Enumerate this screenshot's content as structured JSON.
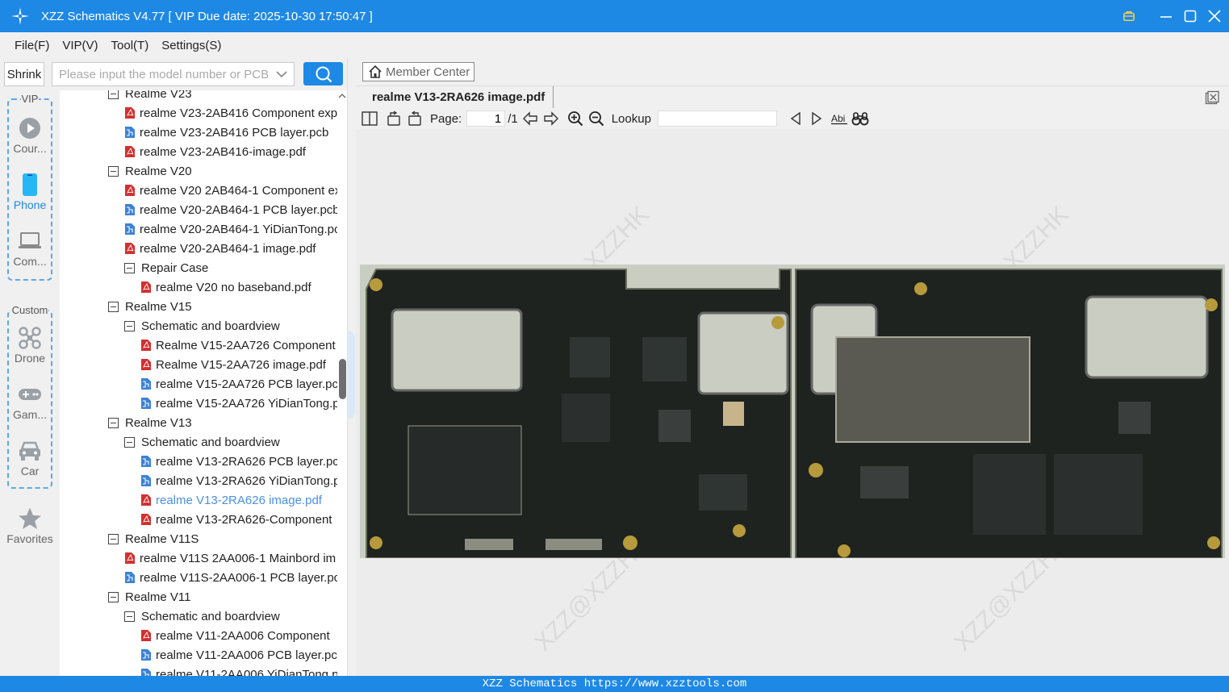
{
  "app": {
    "title": "XZZ Schematics V4.77 [ VIP Due date: 2025-10-30 17:50:47 ]",
    "accent": "#1e88e5"
  },
  "menu": [
    "File(F)",
    "VIP(V)",
    "Tool(T)",
    "Settings(S)"
  ],
  "rail": {
    "shrink_label": "Shrink",
    "vip_label": "VIP",
    "custom_label": "Custom",
    "items": [
      {
        "label": "Cour...",
        "icon": "play-icon"
      },
      {
        "label": "Phone",
        "icon": "phone-icon"
      },
      {
        "label": "Com...",
        "icon": "laptop-icon"
      },
      {
        "label": "Drone",
        "icon": "drone-icon"
      },
      {
        "label": "Gam...",
        "icon": "gamepad-icon"
      },
      {
        "label": "Car",
        "icon": "car-icon"
      },
      {
        "label": "Favorites",
        "icon": "star-icon"
      }
    ]
  },
  "search": {
    "placeholder": "Please input the model number or PCB"
  },
  "tree": [
    {
      "level": 0,
      "type": "folder",
      "label": "Realme V23",
      "partial": true
    },
    {
      "level": 1,
      "type": "pdf",
      "label": "realme V23-2AB416 Component exp"
    },
    {
      "level": 1,
      "type": "pcb",
      "label": "realme V23-2AB416 PCB layer.pcb"
    },
    {
      "level": 1,
      "type": "pdf",
      "label": "realme V23-2AB416-image.pdf"
    },
    {
      "level": 0,
      "type": "folder",
      "label": "Realme V20"
    },
    {
      "level": 1,
      "type": "pdf",
      "label": "realme V20 2AB464-1 Component ex"
    },
    {
      "level": 1,
      "type": "pcb",
      "label": "realme V20-2AB464-1 PCB layer.pcb"
    },
    {
      "level": 1,
      "type": "pcb",
      "label": "realme V20-2AB464-1 YiDianTong.pc"
    },
    {
      "level": 1,
      "type": "pdf",
      "label": "realme V20-2AB464-1 image.pdf"
    },
    {
      "level": 1,
      "type": "folder",
      "label": "Repair Case"
    },
    {
      "level": 2,
      "type": "pdf",
      "label": "realme V20 no baseband.pdf"
    },
    {
      "level": 0,
      "type": "folder",
      "label": "Realme V15"
    },
    {
      "level": 1,
      "type": "folder",
      "label": "Schematic and boardview"
    },
    {
      "level": 2,
      "type": "pdf",
      "label": "Realme V15-2AA726 Component"
    },
    {
      "level": 2,
      "type": "pdf",
      "label": "Realme V15-2AA726 image.pdf"
    },
    {
      "level": 2,
      "type": "pcb",
      "label": "realme V15-2AA726 PCB layer.pcb"
    },
    {
      "level": 2,
      "type": "pcb",
      "label": "realme V15-2AA726 YiDianTong.p"
    },
    {
      "level": 0,
      "type": "folder",
      "label": "Realme V13"
    },
    {
      "level": 1,
      "type": "folder",
      "label": "Schematic and boardview"
    },
    {
      "level": 2,
      "type": "pcb",
      "label": "realme V13-2RA626 PCB layer.pcb"
    },
    {
      "level": 2,
      "type": "pcb",
      "label": "realme V13-2RA626 YiDianTong.p"
    },
    {
      "level": 2,
      "type": "pdf",
      "label": "realme V13-2RA626 image.pdf",
      "selected": true
    },
    {
      "level": 2,
      "type": "pdf",
      "label": "realme V13-2RA626-Component"
    },
    {
      "level": 0,
      "type": "folder",
      "label": "Realme V11S"
    },
    {
      "level": 1,
      "type": "pdf",
      "label": "realme V11S 2AA006-1 Mainbord im"
    },
    {
      "level": 1,
      "type": "pcb",
      "label": "realme V11S-2AA006-1 PCB layer.pcl"
    },
    {
      "level": 0,
      "type": "folder",
      "label": "Realme V11"
    },
    {
      "level": 1,
      "type": "folder",
      "label": "Schematic and boardview"
    },
    {
      "level": 2,
      "type": "pdf",
      "label": "realme V11-2AA006 Component"
    },
    {
      "level": 2,
      "type": "pcb",
      "label": "realme V11-2AA006 PCB layer.pcb"
    },
    {
      "level": 2,
      "type": "pcb",
      "label": "realme V11-2AA006 YiDianTong.p"
    }
  ],
  "viewer": {
    "member_center": "Member Center",
    "tab_title": "realme V13-2RA626 image.pdf",
    "page_label": "Page:",
    "page_value": "1",
    "page_total": "/1",
    "lookup_label": "Lookup",
    "lookup_value": "",
    "watermark": "XZZ@XZZHK"
  },
  "status": {
    "text": "XZZ Schematics https://www.xzztools.com"
  }
}
